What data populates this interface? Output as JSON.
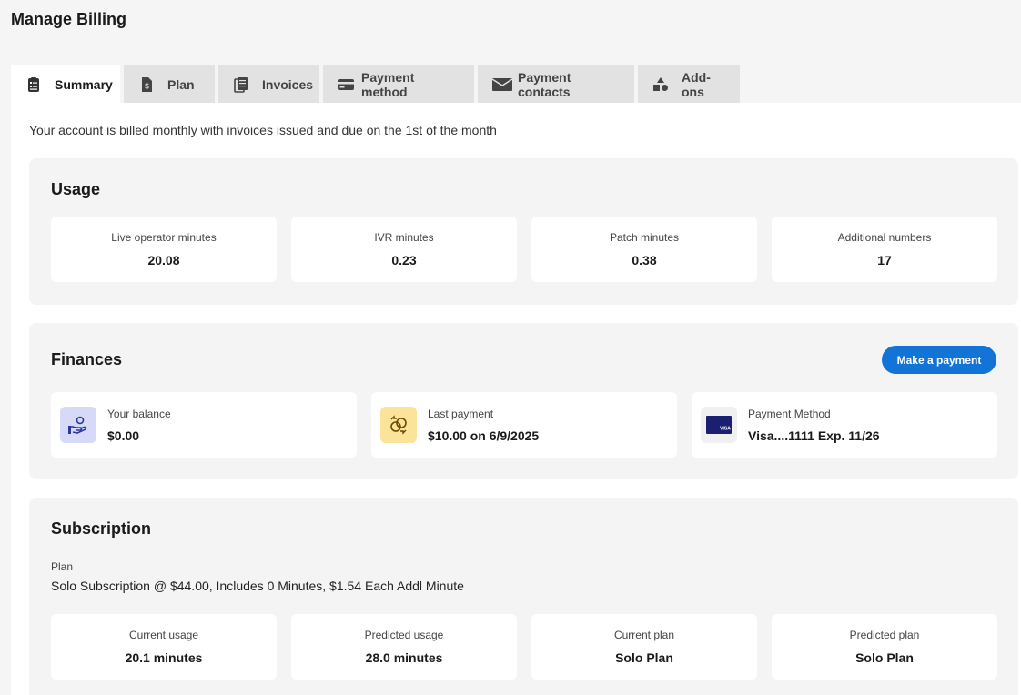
{
  "page": {
    "title": "Manage Billing"
  },
  "tabs": [
    {
      "label": "Summary",
      "icon": "summary-icon",
      "active": true
    },
    {
      "label": "Plan",
      "icon": "dollar-document-icon"
    },
    {
      "label": "Invoices",
      "icon": "documents-icon"
    },
    {
      "label": "Payment method",
      "icon": "credit-card-icon"
    },
    {
      "label": "Payment contacts",
      "icon": "envelope-icon"
    },
    {
      "label": "Add-ons",
      "icon": "shapes-icon"
    }
  ],
  "intro": "Your account is billed monthly with invoices issued and due on the 1st of the month",
  "usage": {
    "title": "Usage",
    "stats": [
      {
        "label": "Live operator minutes",
        "value": "20.08"
      },
      {
        "label": "IVR minutes",
        "value": "0.23"
      },
      {
        "label": "Patch minutes",
        "value": "0.38"
      },
      {
        "label": "Additional numbers",
        "value": "17"
      }
    ]
  },
  "finances": {
    "title": "Finances",
    "button": "Make a payment",
    "cards": [
      {
        "label": "Your balance",
        "value": "$0.00",
        "icon": "hand-coin-icon"
      },
      {
        "label": "Last payment",
        "value": "$10.00 on 6/9/2025",
        "icon": "exchange-coins-icon"
      },
      {
        "label": "Payment Method",
        "value": "Visa....1111 Exp. 11/26",
        "icon": "visa-card-icon",
        "card_text": "VISA"
      }
    ]
  },
  "subscription": {
    "title": "Subscription",
    "plan_label": "Plan",
    "plan_value": "Solo Subscription @ $44.00, Includes 0 Minutes, $1.54 Each Addl Minute",
    "stats": [
      {
        "label": "Current usage",
        "value": "20.1 minutes"
      },
      {
        "label": "Predicted usage",
        "value": "28.0 minutes"
      },
      {
        "label": "Current plan",
        "value": "Solo Plan"
      },
      {
        "label": "Predicted plan",
        "value": "Solo Plan"
      }
    ]
  },
  "colors": {
    "accent": "#1274d6",
    "balance_icon_bg": "#d7d9f8",
    "last_payment_icon_bg": "#fbe39a",
    "visa_blue": "#1a1f71"
  }
}
